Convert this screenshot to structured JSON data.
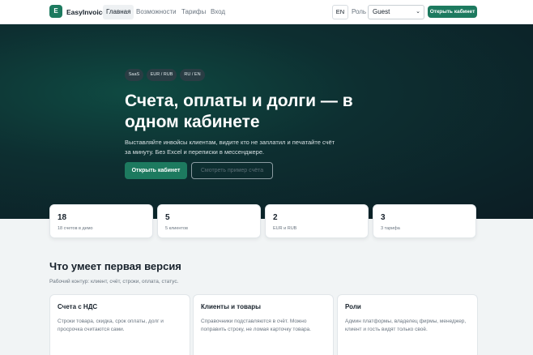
{
  "header": {
    "logo_letter": "E",
    "brand": "EasyInvoice",
    "nav": [
      {
        "label": "Главная",
        "active": true
      },
      {
        "label": "Возможности",
        "active": false
      },
      {
        "label": "Тарифы",
        "active": false
      },
      {
        "label": "Вход",
        "active": false
      }
    ],
    "lang": "EN",
    "role_label": "Роль",
    "role_value": "Guest",
    "cta": "Открыть кабинет"
  },
  "hero": {
    "tags": [
      "SaaS",
      "EUR / RUB",
      "RU / EN"
    ],
    "title": "Счета, оплаты и долги — в одном кабинете",
    "subtitle": "Выставляйте инвойсы клиентам, видите кто не заплатил и печатайте счёт за минуту. Без Excel и переписки в мессенджере.",
    "primary_button": "Открыть кабинет",
    "secondary_button": "Смотреть пример счёта"
  },
  "stats": [
    {
      "value": "18",
      "label": "18 счетов в демо"
    },
    {
      "value": "5",
      "label": "5 клиентов"
    },
    {
      "value": "2",
      "label": "EUR и RUB"
    },
    {
      "value": "3",
      "label": "3 тарифа"
    }
  ],
  "features_section": {
    "title": "Что умеет первая версия",
    "subtitle": "Рабочий контур: клиент, счёт, строки, оплата, статус.",
    "items": [
      {
        "title": "Счета с НДС",
        "desc": "Строки товара, скидка, срок оплаты, долг и просрочка считаются сами."
      },
      {
        "title": "Клиенты и товары",
        "desc": "Справочники подставляются в счёт. Можно поправить строку, не ломая карточку товара."
      },
      {
        "title": "Роли",
        "desc": "Админ платформы, владелец фирмы, менеджер, клиент и гость видят только своё."
      }
    ]
  },
  "colors": {
    "accent": "#1d7a5f",
    "hero_bg": "#0c1d24"
  }
}
